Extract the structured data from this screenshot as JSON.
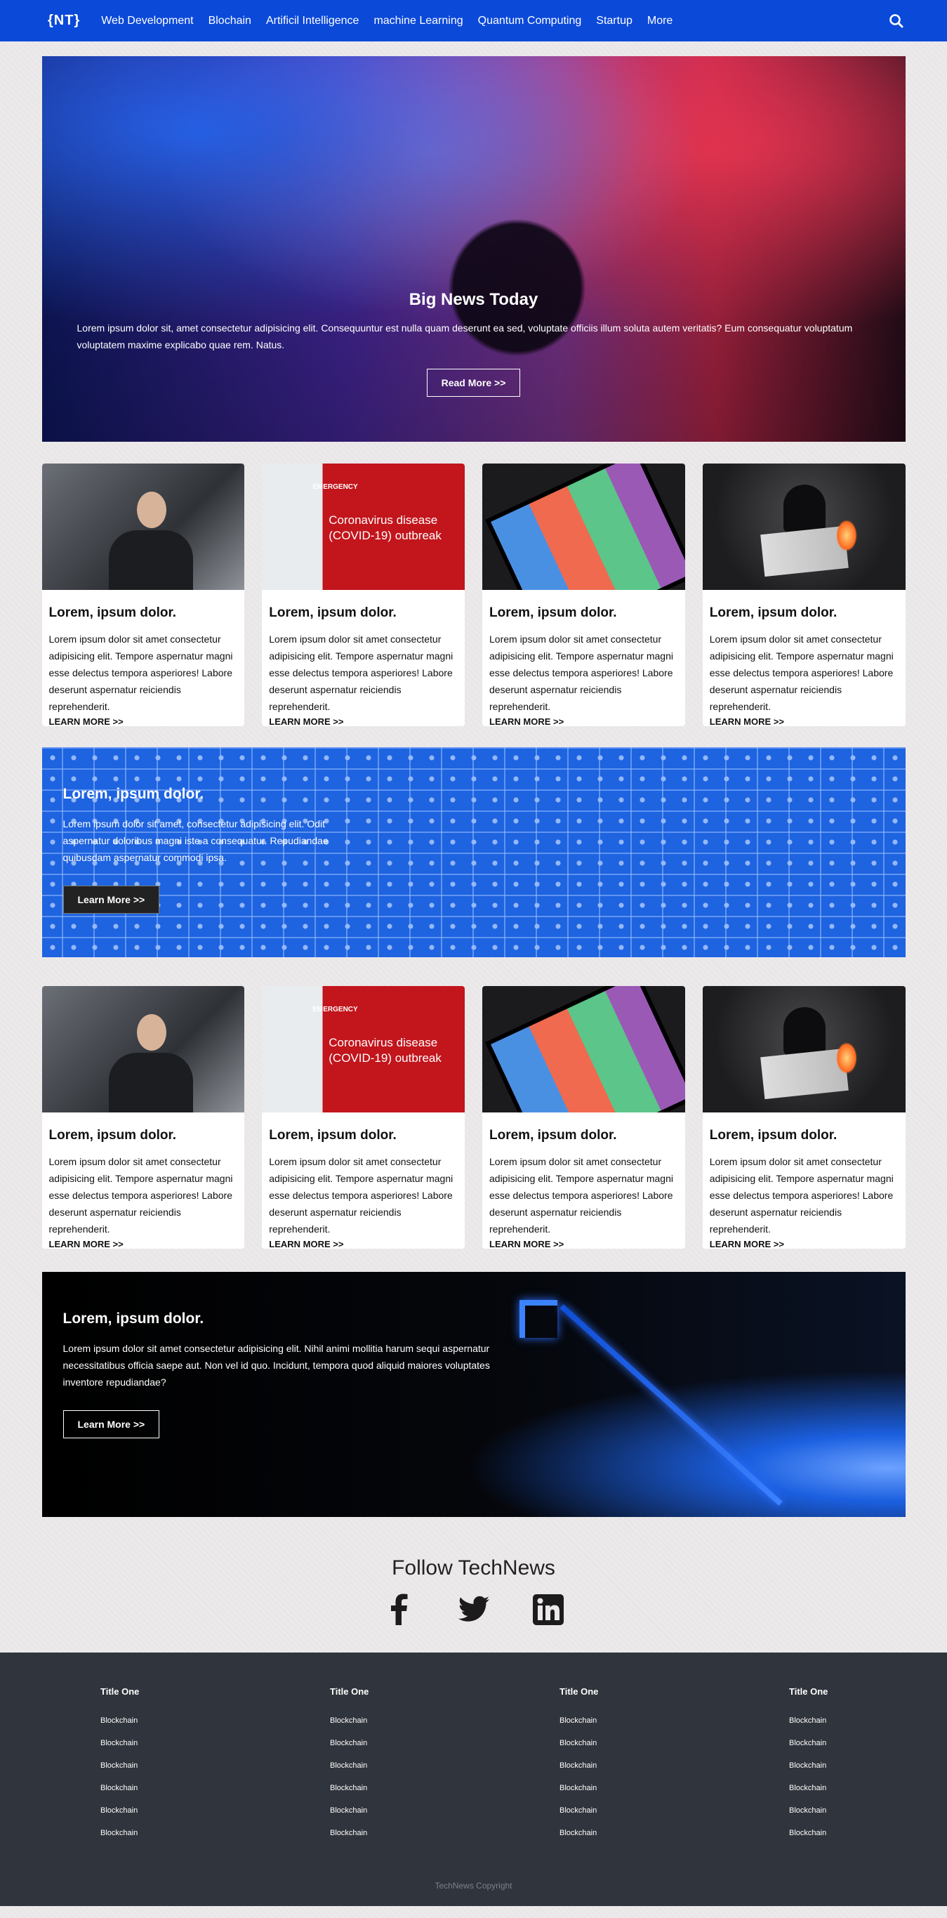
{
  "nav": {
    "logo": "{NT}",
    "links": [
      "Web Development",
      "Blochain",
      "Artificil Intelligence",
      "machine Learning",
      "Quantum Computing",
      "Startup",
      "More"
    ],
    "search_icon": "search-icon"
  },
  "hero": {
    "title": "Big News Today",
    "text": "Lorem ipsum dolor sit, amet consectetur adipisicing elit. Consequuntur est nulla quam deserunt ea sed, voluptate officiis illum soluta autem veritatis? Eum consequatur voluptatum voluptatem maxime explicabo quae rem. Natus.",
    "button": "Read More >>"
  },
  "cards_top": [
    {
      "title": "Lorem, ipsum dolor.",
      "text": "Lorem ipsum dolor sit amet consectetur adipisicing elit. Tempore aspernatur magni esse delectus tempora asperiores! Labore deserunt aspernatur reiciendis reprehenderit.",
      "link": "LEARN MORE >>"
    },
    {
      "title": "Lorem, ipsum dolor.",
      "text": "Lorem ipsum dolor sit amet consectetur adipisicing elit. Tempore aspernatur magni esse delectus tempora asperiores! Labore deserunt aspernatur reiciendis reprehenderit.",
      "link": "LEARN MORE >>"
    },
    {
      "title": "Lorem, ipsum dolor.",
      "text": "Lorem ipsum dolor sit amet consectetur adipisicing elit. Tempore aspernatur magni esse delectus tempora asperiores! Labore deserunt aspernatur reiciendis reprehenderit.",
      "link": "LEARN MORE >>"
    },
    {
      "title": "Lorem, ipsum dolor.",
      "text": "Lorem ipsum dolor sit amet consectetur adipisicing elit. Tempore aspernatur magni esse delectus tempora asperiores! Labore deserunt aspernatur reiciendis reprehenderit.",
      "link": "LEARN MORE >>"
    }
  ],
  "sign_image": {
    "label": "EMERGENCY",
    "text": "Coronavirus disease (COVID-19) outbreak"
  },
  "promo_blue": {
    "title": "Lorem, ipsum dolor.",
    "text": "Lorem ipsum dolor sit amet, consectetur adipisicing elit. Odit aspernatur doloribus magni iste a consequatur. Repudiandae quibusdam aspernatur commodi ipsa.",
    "button": "Learn More >>"
  },
  "cards_bottom": [
    {
      "title": "Lorem, ipsum dolor.",
      "text": "Lorem ipsum dolor sit amet consectetur adipisicing elit. Tempore aspernatur magni esse delectus tempora asperiores! Labore deserunt aspernatur reiciendis reprehenderit.",
      "link": "LEARN MORE >>"
    },
    {
      "title": "Lorem, ipsum dolor.",
      "text": "Lorem ipsum dolor sit amet consectetur adipisicing elit. Tempore aspernatur magni esse delectus tempora asperiores! Labore deserunt aspernatur reiciendis reprehenderit.",
      "link": "LEARN MORE >>"
    },
    {
      "title": "Lorem, ipsum dolor.",
      "text": "Lorem ipsum dolor sit amet consectetur adipisicing elit. Tempore aspernatur magni esse delectus tempora asperiores! Labore deserunt aspernatur reiciendis reprehenderit.",
      "link": "LEARN MORE >>"
    },
    {
      "title": "Lorem, ipsum dolor.",
      "text": "Lorem ipsum dolor sit amet consectetur adipisicing elit. Tempore aspernatur magni esse delectus tempora asperiores! Labore deserunt aspernatur reiciendis reprehenderit.",
      "link": "LEARN MORE >>"
    }
  ],
  "promo_dark": {
    "title": "Lorem, ipsum dolor.",
    "text": "Lorem ipsum dolor sit amet consectetur adipisicing elit. Nihil animi mollitia harum sequi aspernatur necessitatibus officia saepe aut. Non vel id quo. Incidunt, tempora quod aliquid maiores voluptates inventore repudiandae?",
    "button": "Learn More >>"
  },
  "follow": {
    "title": "Follow TechNews",
    "icons": [
      "facebook-icon",
      "twitter-icon",
      "linkedin-icon"
    ]
  },
  "footer": {
    "columns": [
      {
        "title": "Title One",
        "items": [
          "Blockchain",
          "Blockchain",
          "Blockchain",
          "Blockchain",
          "Blockchain",
          "Blockchain"
        ]
      },
      {
        "title": "Title One",
        "items": [
          "Blockchain",
          "Blockchain",
          "Blockchain",
          "Blockchain",
          "Blockchain",
          "Blockchain"
        ]
      },
      {
        "title": "Title One",
        "items": [
          "Blockchain",
          "Blockchain",
          "Blockchain",
          "Blockchain",
          "Blockchain",
          "Blockchain"
        ]
      },
      {
        "title": "Title One",
        "items": [
          "Blockchain",
          "Blockchain",
          "Blockchain",
          "Blockchain",
          "Blockchain",
          "Blockchain"
        ]
      }
    ],
    "copyright": "TechNews Copyright"
  },
  "colors": {
    "nav": "#0b49d9",
    "footer": "#30343c",
    "background": "#ece9ea"
  }
}
